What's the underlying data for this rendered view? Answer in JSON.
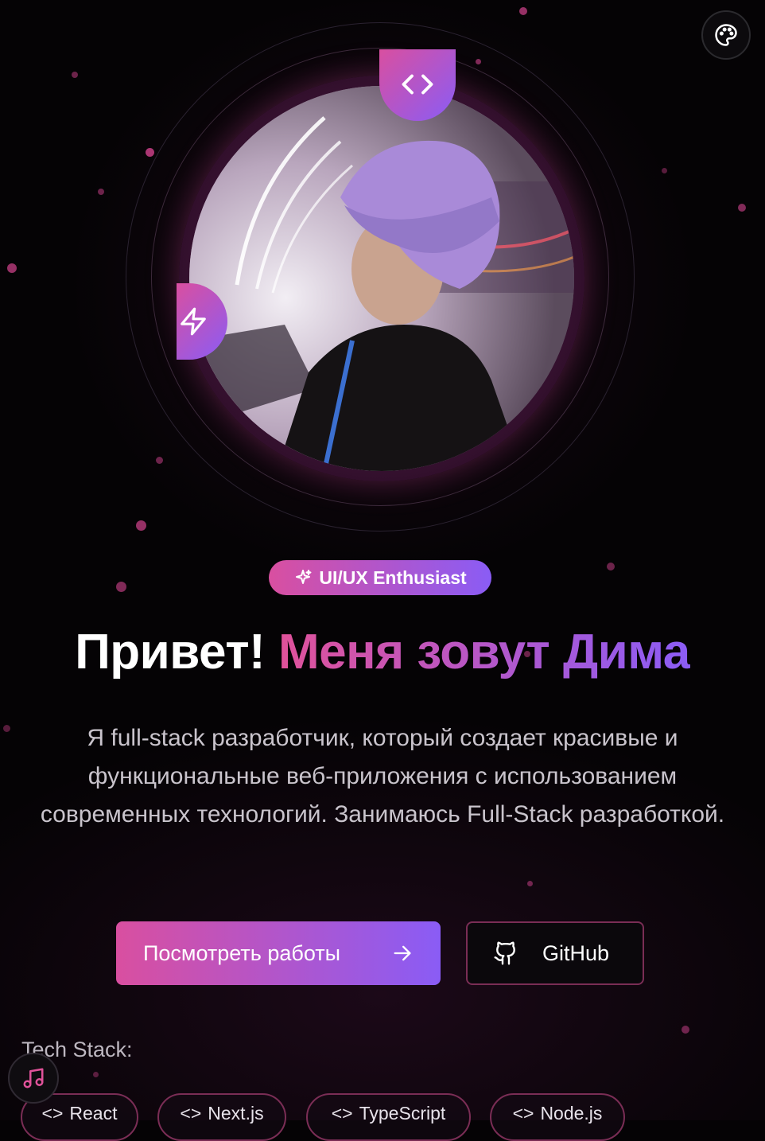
{
  "chip": {
    "label": "UI/UX Enthusiast"
  },
  "hero": {
    "title_plain": "Привет!",
    "title_accent": "Меня зовут Дима",
    "description": "Я full-stack разработчик, который создает красивые и функциональные веб-приложения с использованием современных технологий. Занимаюсь Full-Stack разработкой."
  },
  "buttons": {
    "primary_label": "Посмотреть работы",
    "secondary_label": "GitHub"
  },
  "tech_stack": {
    "label": "Tech Stack:",
    "tags": [
      "React",
      "Next.js",
      "TypeScript",
      "Node.js"
    ]
  },
  "icons": {
    "theme": "palette-icon",
    "code_badge": "code-icon",
    "bolt_badge": "bolt-icon",
    "chip": "sparkles-icon",
    "primary_button": "arrow-right-icon",
    "secondary_button": "github-icon",
    "music": "music-note-icon",
    "tag": "code-icon"
  },
  "colors": {
    "accent_pink": "#d94fa0",
    "accent_purple": "#8a5cf5",
    "background": "#050305"
  }
}
